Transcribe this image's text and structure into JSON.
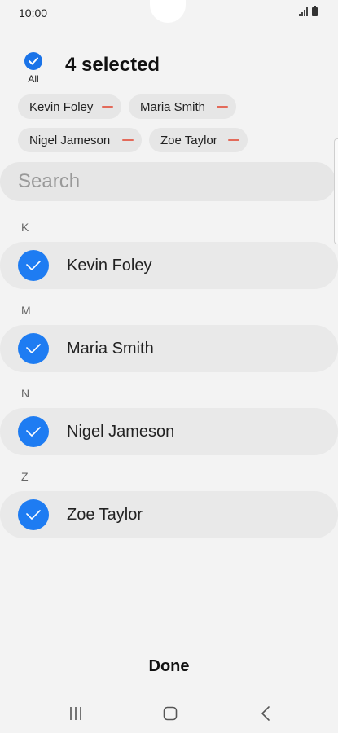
{
  "status_bar": {
    "time": "10:00",
    "signal_icon": "signal-icon",
    "battery_icon": "battery-icon"
  },
  "header": {
    "select_all_label": "All",
    "selected_count": "4 selected",
    "accent_color": "#1a73e8"
  },
  "chips": [
    {
      "label": "Kevin Foley"
    },
    {
      "label": "Maria Smith"
    },
    {
      "label": "Nigel Jameson"
    },
    {
      "label": "Zoe Taylor"
    }
  ],
  "search": {
    "placeholder": "Search"
  },
  "sections": [
    {
      "letter": "K",
      "contact": "Kevin Foley",
      "checked": true
    },
    {
      "letter": "M",
      "contact": "Maria Smith",
      "checked": true
    },
    {
      "letter": "N",
      "contact": "Nigel Jameson",
      "checked": true
    },
    {
      "letter": "Z",
      "contact": "Zoe Taylor",
      "checked": true
    }
  ],
  "footer": {
    "done_label": "Done"
  },
  "nav_bar": {
    "icons": [
      "recent-apps-icon",
      "home-icon",
      "back-icon"
    ]
  }
}
